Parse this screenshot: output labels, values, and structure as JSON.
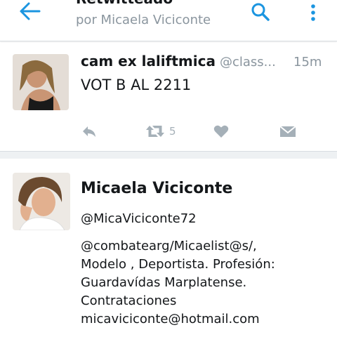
{
  "header": {
    "title": "Retwitteado",
    "subtitle": "por Micaela Viciconte",
    "back_icon": "arrow-left-icon",
    "search_icon": "search-icon",
    "menu_icon": "more-vertical-icon"
  },
  "tweet": {
    "author_name": "cam ex laliftmica",
    "author_handle": "@class...",
    "time": "15m",
    "text": "VOT B AL 2211",
    "retweet_count": "5"
  },
  "profile": {
    "name": "Micaela Viciconte",
    "handle": "@MicaViciconte72",
    "bio": [
      "@combatearg/Micaelist@s/,",
      "Modelo , Deportista. Profesión:",
      "Guardavídas Marplatense.",
      "Contrataciones",
      "micaviciconte@hotmail.com"
    ]
  },
  "colors": {
    "accent": "#1b95e0",
    "muted": "#8a959e",
    "icon_gray": "#a5b0b8"
  }
}
